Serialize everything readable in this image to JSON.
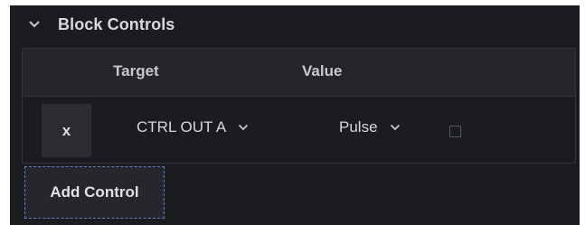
{
  "section": {
    "title": "Block Controls",
    "icon": "chevron-down-icon"
  },
  "table": {
    "headers": {
      "target": "Target",
      "value": "Value"
    },
    "rows": [
      {
        "remove_label": "x",
        "target": "CTRL OUT A",
        "value": "Pulse",
        "checked": false
      }
    ]
  },
  "add_control_label": "Add Control",
  "colors": {
    "panel_bg": "#1b1c20",
    "header_bg": "#23252a",
    "border": "#34363c",
    "focus_outline": "#4d86c8",
    "text": "#d6d7db"
  }
}
